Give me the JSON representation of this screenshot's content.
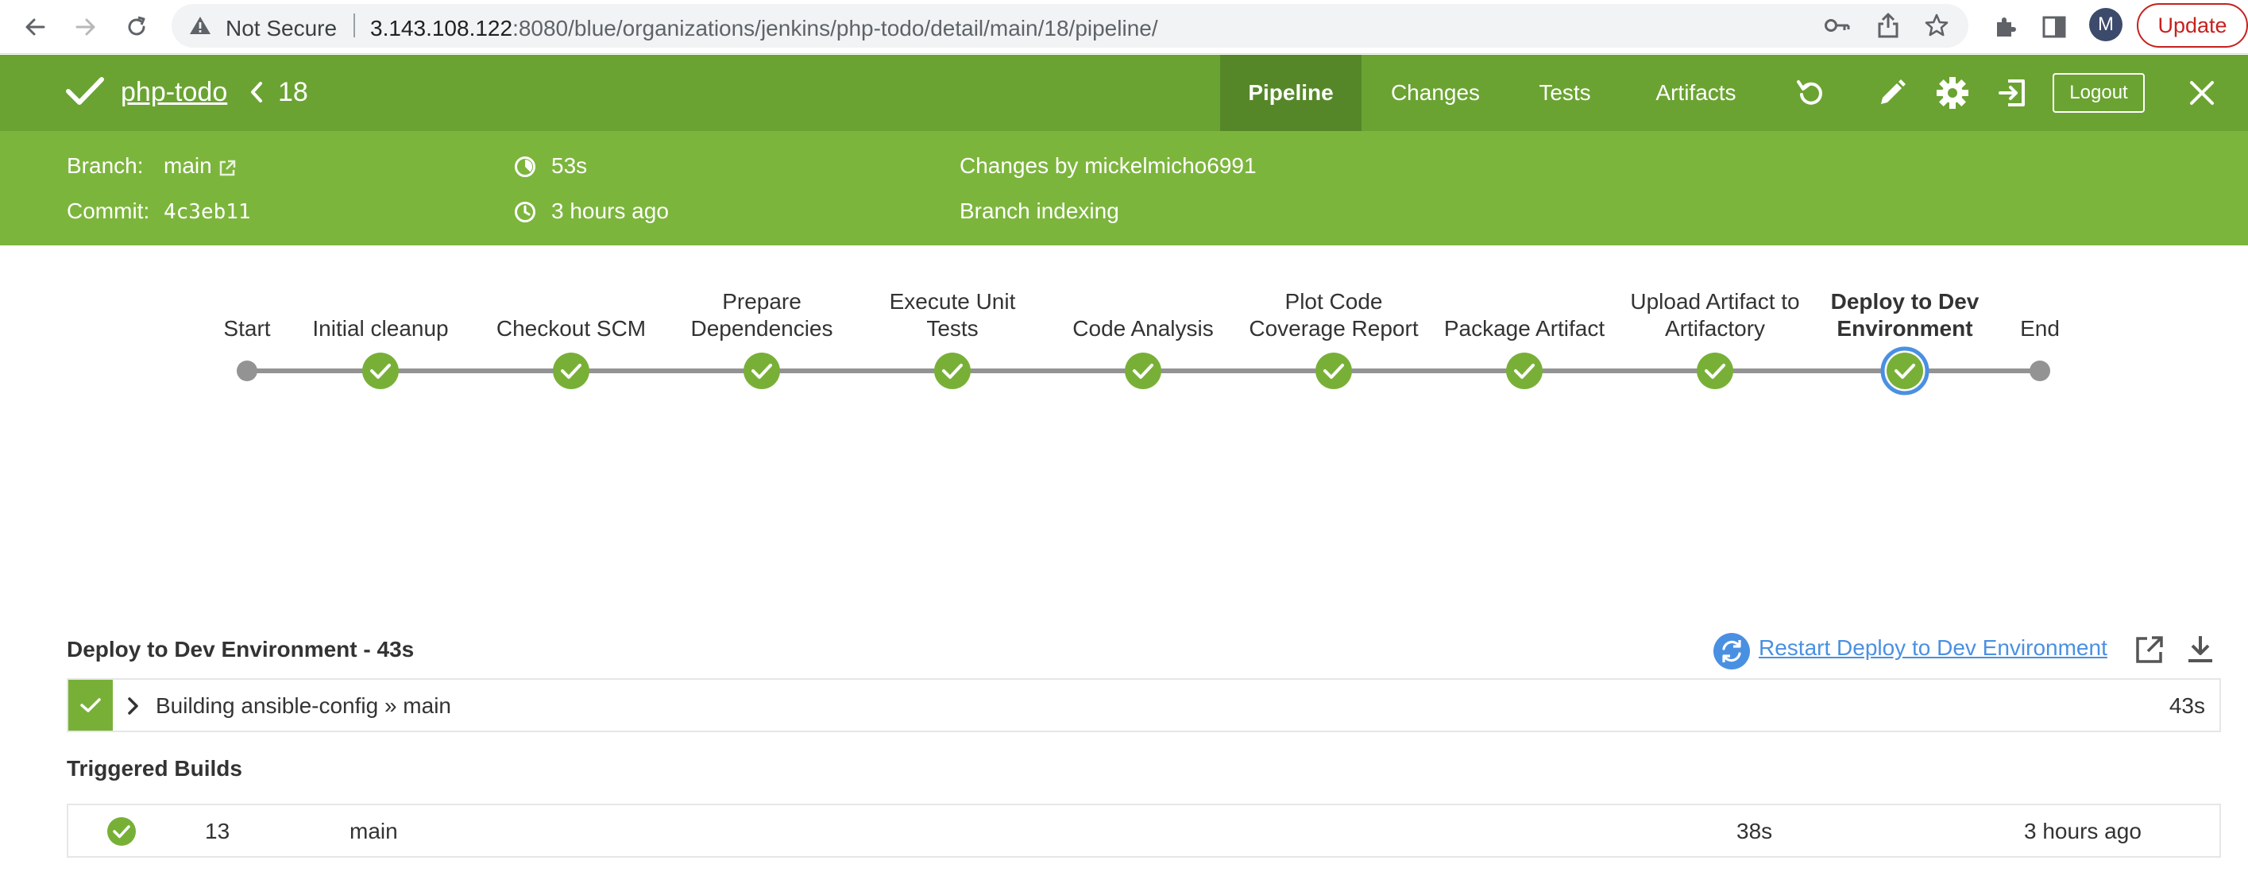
{
  "browser": {
    "security_label": "Not Secure",
    "url_host": "3.143.108.122",
    "url_rest": ":8080/blue/organizations/jenkins/php-todo/detail/main/18/pipeline/",
    "profile_initial": "M",
    "update_label": "Update"
  },
  "header": {
    "project_name": "php-todo",
    "run_number": "18",
    "tabs": [
      {
        "label": "Pipeline",
        "active": true
      },
      {
        "label": "Changes",
        "active": false
      },
      {
        "label": "Tests",
        "active": false
      },
      {
        "label": "Artifacts",
        "active": false
      }
    ],
    "logout_label": "Logout",
    "brand_color": "#6aa332"
  },
  "info": {
    "branch_key": "Branch:",
    "branch_value": "main",
    "commit_key": "Commit:",
    "commit_value": "4c3eb11",
    "duration": "53s",
    "started": "3 hours ago",
    "changes_by": "Changes by mickelmicho6991",
    "cause": "Branch indexing"
  },
  "pipeline": {
    "stages": [
      {
        "lines": [
          "Start"
        ],
        "kind": "terminal"
      },
      {
        "lines": [
          "Initial cleanup"
        ],
        "kind": "success"
      },
      {
        "lines": [
          "Checkout SCM"
        ],
        "kind": "success"
      },
      {
        "lines": [
          "Prepare",
          "Dependencies"
        ],
        "kind": "success"
      },
      {
        "lines": [
          "Execute Unit",
          "Tests"
        ],
        "kind": "success"
      },
      {
        "lines": [
          "Code Analysis"
        ],
        "kind": "success"
      },
      {
        "lines": [
          "Plot Code",
          "Coverage Report"
        ],
        "kind": "success"
      },
      {
        "lines": [
          "Package Artifact"
        ],
        "kind": "success"
      },
      {
        "lines": [
          "Upload Artifact to",
          "Artifactory"
        ],
        "kind": "success"
      },
      {
        "lines": [
          "Deploy to Dev",
          "Environment"
        ],
        "kind": "selected"
      },
      {
        "lines": [
          "End"
        ],
        "kind": "terminal"
      }
    ],
    "success_color": "#78b037",
    "selected_ring_color": "#4a90e2"
  },
  "step": {
    "title": "Deploy to Dev Environment - 43s",
    "restart_label": "Restart Deploy to Dev Environment",
    "log": {
      "text": "Building ansible-config » main",
      "duration": "43s"
    }
  },
  "triggered": {
    "title": "Triggered Builds",
    "rows": [
      {
        "number": "13",
        "branch": "main",
        "duration": "38s",
        "when": "3 hours ago"
      }
    ]
  }
}
